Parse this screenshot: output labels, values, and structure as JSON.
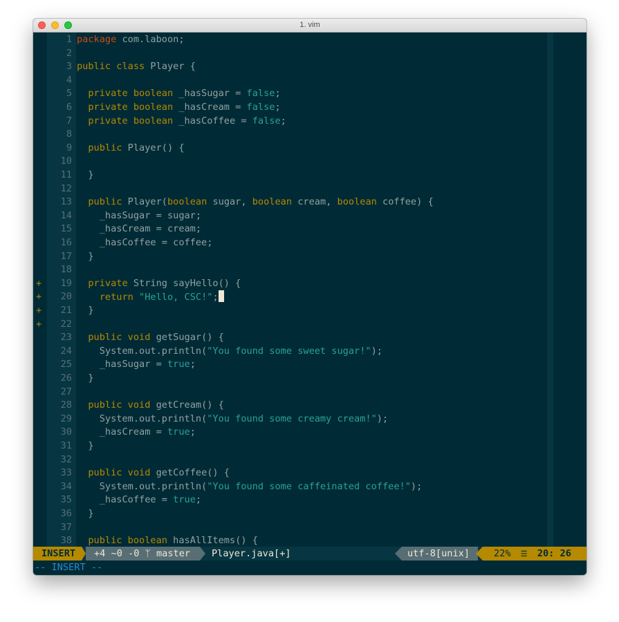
{
  "window": {
    "title": "1. vim"
  },
  "editor": {
    "lines": [
      {
        "n": "1",
        "sign": "",
        "html": "<span class='pk'>package</span> com.laboon;"
      },
      {
        "n": "2",
        "sign": "",
        "html": ""
      },
      {
        "n": "3",
        "sign": "",
        "html": "<span class='kw'>public class</span> Player {"
      },
      {
        "n": "4",
        "sign": "",
        "html": ""
      },
      {
        "n": "5",
        "sign": "",
        "html": "  <span class='kw'>private boolean</span> _hasSugar = <span class='bool'>false</span>;"
      },
      {
        "n": "6",
        "sign": "",
        "html": "  <span class='kw'>private boolean</span> _hasCream = <span class='bool'>false</span>;"
      },
      {
        "n": "7",
        "sign": "",
        "html": "  <span class='kw'>private boolean</span> _hasCoffee = <span class='bool'>false</span>;"
      },
      {
        "n": "8",
        "sign": "",
        "html": ""
      },
      {
        "n": "9",
        "sign": "",
        "html": "  <span class='kw'>public</span> Player() {"
      },
      {
        "n": "10",
        "sign": "",
        "html": ""
      },
      {
        "n": "11",
        "sign": "",
        "html": "  }"
      },
      {
        "n": "12",
        "sign": "",
        "html": ""
      },
      {
        "n": "13",
        "sign": "",
        "html": "  <span class='kw'>public</span> Player(<span class='kw'>boolean</span> sugar, <span class='kw'>boolean</span> cream, <span class='kw'>boolean</span> coffee) {"
      },
      {
        "n": "14",
        "sign": "",
        "html": "    _hasSugar = sugar;"
      },
      {
        "n": "15",
        "sign": "",
        "html": "    _hasCream = cream;"
      },
      {
        "n": "16",
        "sign": "",
        "html": "    _hasCoffee = coffee;"
      },
      {
        "n": "17",
        "sign": "",
        "html": "  }"
      },
      {
        "n": "18",
        "sign": "",
        "html": ""
      },
      {
        "n": "19",
        "sign": "+",
        "html": "  <span class='kw'>private</span> String sayHello() {"
      },
      {
        "n": "20",
        "sign": "+",
        "html": "    <span class='kw'>return</span> <span class='str'>\"Hello, CSC!\"</span>;<span class='cursor'></span>"
      },
      {
        "n": "21",
        "sign": "+",
        "html": "  }"
      },
      {
        "n": "22",
        "sign": "+",
        "html": ""
      },
      {
        "n": "23",
        "sign": "",
        "html": "  <span class='kw'>public void</span> getSugar() {"
      },
      {
        "n": "24",
        "sign": "",
        "html": "    System.out.println(<span class='str'>\"You found some sweet sugar!\"</span>);"
      },
      {
        "n": "25",
        "sign": "",
        "html": "    _hasSugar = <span class='bool'>true</span>;"
      },
      {
        "n": "26",
        "sign": "",
        "html": "  }"
      },
      {
        "n": "27",
        "sign": "",
        "html": ""
      },
      {
        "n": "28",
        "sign": "",
        "html": "  <span class='kw'>public void</span> getCream() {"
      },
      {
        "n": "29",
        "sign": "",
        "html": "    System.out.println(<span class='str'>\"You found some creamy cream!\"</span>);"
      },
      {
        "n": "30",
        "sign": "",
        "html": "    _hasCream = <span class='bool'>true</span>;"
      },
      {
        "n": "31",
        "sign": "",
        "html": "  }"
      },
      {
        "n": "32",
        "sign": "",
        "html": ""
      },
      {
        "n": "33",
        "sign": "",
        "html": "  <span class='kw'>public void</span> getCoffee() {"
      },
      {
        "n": "34",
        "sign": "",
        "html": "    System.out.println(<span class='str'>\"You found some caffeinated coffee!\"</span>);"
      },
      {
        "n": "35",
        "sign": "",
        "html": "    _hasCoffee = <span class='bool'>true</span>;"
      },
      {
        "n": "36",
        "sign": "",
        "html": "  }"
      },
      {
        "n": "37",
        "sign": "",
        "html": ""
      },
      {
        "n": "38",
        "sign": "",
        "html": "  <span class='kw'>public boolean</span> hasAllItems() {"
      }
    ]
  },
  "statusline": {
    "mode": "INSERT",
    "git": "+4 ~0 -0 ᛘ master",
    "file": "Player.java[+]",
    "encoding": "utf-8[unix]",
    "percent": "22%",
    "ln_icon": "☰",
    "position": "20: 26"
  },
  "cmdline": "-- INSERT --",
  "colors": {
    "background": "#002b36",
    "keyword": "#b58900",
    "string": "#2aa198",
    "package": "#cb4b16",
    "git_sign": "#b58900",
    "cmdline": "#268bd2"
  }
}
